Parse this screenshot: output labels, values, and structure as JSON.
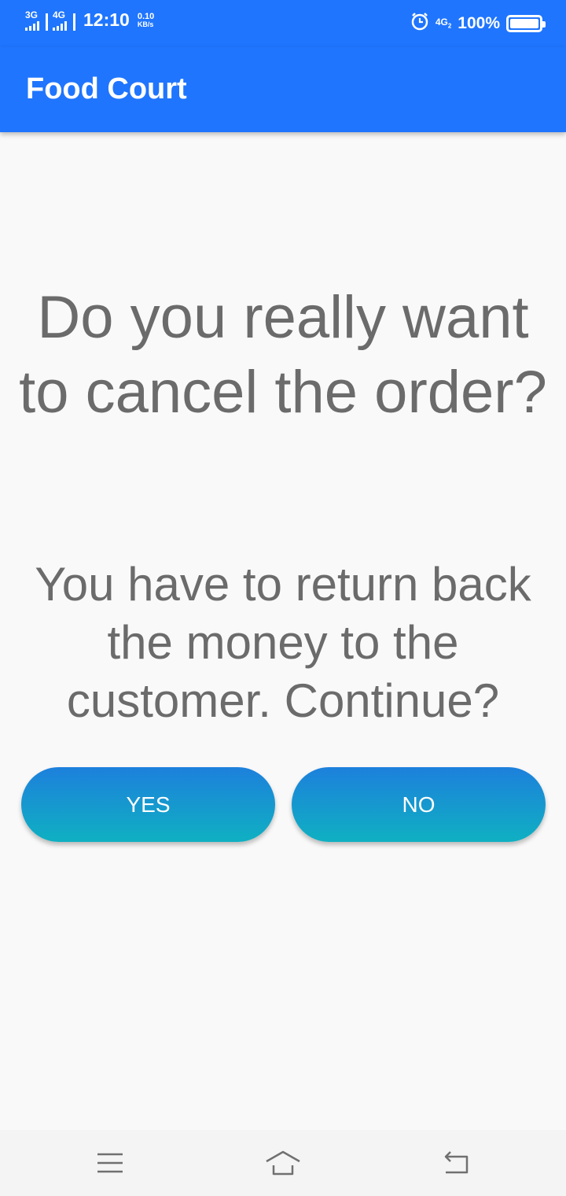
{
  "status_bar": {
    "sim1": "3G",
    "sim2": "4G",
    "time": "12:10",
    "speed_value": "0.10",
    "speed_unit": "KB/s",
    "network": "4G",
    "network_sub": "2",
    "battery": "100%"
  },
  "app_bar": {
    "title": "Food Court"
  },
  "dialog": {
    "question": "Do you really want to cancel the order?",
    "message": "You have to return back the money to the customer. Continue?",
    "yes_label": "YES",
    "no_label": "NO"
  },
  "nav": {
    "icons": [
      "menu-icon",
      "home-icon",
      "back-icon"
    ]
  },
  "colors": {
    "primary": "#1f75fe",
    "button_top": "#1d80dc",
    "button_bottom": "#0fb0c2",
    "text_gray": "#6b6b6b"
  }
}
